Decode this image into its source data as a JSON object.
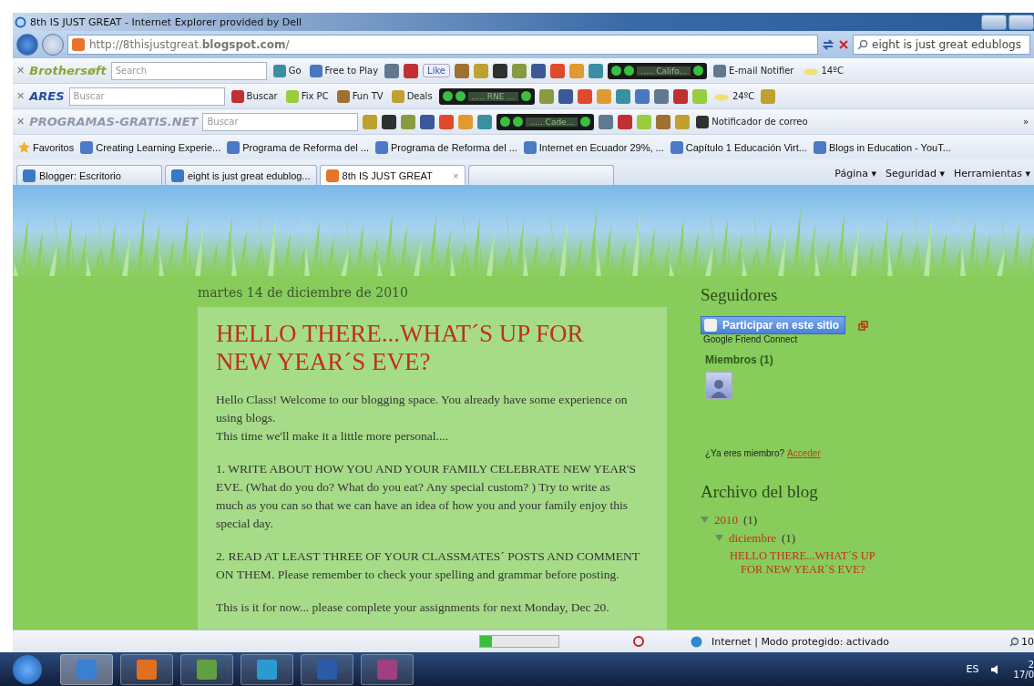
{
  "window": {
    "title": "8th IS JUST GREAT - Internet Explorer provided by Dell"
  },
  "address_bar": {
    "url": "http://8thisjustgreat.**blogspot.com**/",
    "search_value": "eight is just great edublogs"
  },
  "toolbars": [
    {
      "close": "✕",
      "items": [
        {
          "kind": "logo",
          "label": "Brothersøft"
        },
        {
          "kind": "search",
          "placeholder": "Search"
        },
        {
          "kind": "button",
          "label": "Go"
        },
        {
          "kind": "button",
          "label": "Free to Play"
        },
        {
          "kind": "icon"
        },
        {
          "kind": "icon"
        },
        {
          "kind": "like",
          "label": "Like"
        },
        {
          "kind": "icon"
        },
        {
          "kind": "icon"
        },
        {
          "kind": "icon"
        },
        {
          "kind": "icon"
        },
        {
          "kind": "icon"
        },
        {
          "kind": "icon"
        },
        {
          "kind": "icon"
        },
        {
          "kind": "icon"
        },
        {
          "kind": "player",
          "label": "..... Califo..."
        },
        {
          "kind": "button",
          "label": "E-mail Notifier"
        },
        {
          "kind": "weather",
          "label": "14ºC"
        }
      ]
    },
    {
      "close": "✕",
      "items": [
        {
          "kind": "logo",
          "label": "ARES"
        },
        {
          "kind": "search",
          "placeholder": "Buscar"
        },
        {
          "kind": "button",
          "label": "Buscar"
        },
        {
          "kind": "button",
          "label": "Fix PC"
        },
        {
          "kind": "button",
          "label": "Fun TV"
        },
        {
          "kind": "button",
          "label": "Deals"
        },
        {
          "kind": "player",
          "label": "..... RNE ..."
        },
        {
          "kind": "icon"
        },
        {
          "kind": "icon"
        },
        {
          "kind": "icon"
        },
        {
          "kind": "icon"
        },
        {
          "kind": "icon"
        },
        {
          "kind": "icon"
        },
        {
          "kind": "icon"
        },
        {
          "kind": "icon"
        },
        {
          "kind": "icon"
        },
        {
          "kind": "weather",
          "label": "24ºC"
        },
        {
          "kind": "icon"
        }
      ]
    },
    {
      "close": "✕",
      "items": [
        {
          "kind": "logo",
          "label": "PROGRAMAS-GRATIS.NET"
        },
        {
          "kind": "search",
          "placeholder": "Buscar"
        },
        {
          "kind": "icon"
        },
        {
          "kind": "icon"
        },
        {
          "kind": "icon"
        },
        {
          "kind": "icon"
        },
        {
          "kind": "icon"
        },
        {
          "kind": "icon"
        },
        {
          "kind": "icon"
        },
        {
          "kind": "player",
          "label": "..... Cade..."
        },
        {
          "kind": "icon"
        },
        {
          "kind": "icon"
        },
        {
          "kind": "icon"
        },
        {
          "kind": "icon"
        },
        {
          "kind": "icon"
        },
        {
          "kind": "button",
          "label": "Notificador de correo"
        },
        {
          "kind": "more",
          "label": "»"
        }
      ]
    }
  ],
  "favorites_bar": {
    "label": "Favoritos",
    "items": [
      "Creating Learning Experie...",
      "Programa de Reforma del ...",
      "Programa de Reforma del ...",
      "Internet en Ecuador 29%, ...",
      "Capítulo 1 Educación Virt...",
      "Blogs in Education - YouT..."
    ]
  },
  "tabs": [
    {
      "label": "Blogger: Escritorio",
      "selected": false
    },
    {
      "label": "eight is just great edublog...",
      "selected": false
    },
    {
      "label": "8th IS JUST GREAT",
      "selected": true,
      "close": "×"
    }
  ],
  "command_bar": [
    {
      "label": "Página",
      "caret": "▾"
    },
    {
      "label": "Seguridad",
      "caret": "▾"
    },
    {
      "label": "Herramientas",
      "caret": "▾"
    }
  ],
  "post": {
    "date": "martes 14 de diciembre de 2010",
    "title": "HELLO THERE...WHAT´S UP FOR NEW YEAR´S EVE?",
    "paragraphs": [
      [
        "Hello Class! Welcome to our blogging space.  You already have some experience on using blogs.",
        "This time we'll make it a little more personal...."
      ],
      [
        "1. WRITE ABOUT HOW YOU AND YOUR FAMILY CELEBRATE NEW YEAR'S EVE. (What do you do?  What do you eat? Any special custom? ) Try to write as much as you can so that we can have an idea of how you and your family enjoy this special day."
      ],
      [
        "2. READ AT LEAST THREE OF YOUR CLASSMATES´ POSTS AND COMMENT ON THEM. Please remember to check your spelling and grammar before posting."
      ],
      [
        "This is it for now... please complete your assignments for next Monday, Dec 20."
      ]
    ]
  },
  "sidebar": {
    "followers": {
      "heading": "Seguidores",
      "join_button": "Participar en este sitio",
      "provider": "Google Friend Connect",
      "members": "Miembros (1)",
      "member_prompt": "¿Ya eres miembro?",
      "sign_in": "Acceder"
    },
    "archive": {
      "heading": "Archivo del blog",
      "tree": [
        {
          "label": "2010",
          "count": "(1)",
          "expanded": true,
          "children": [
            {
              "label": "diciembre",
              "count": "(1)",
              "expanded": true,
              "children": [
                {
                  "label": "HELLO THERE...WHAT´S UP FOR NEW YEAR´S EVE?"
                }
              ]
            }
          ]
        }
      ]
    }
  },
  "status_bar": {
    "level": 0.15,
    "zone": "Internet | Modo protegido: activado",
    "zoom": "10"
  },
  "taskbar": {
    "apps": [
      {
        "color": "#3a80d0",
        "selected": true
      },
      {
        "color": "#e07020",
        "selected": false
      },
      {
        "color": "#60a040",
        "selected": false
      },
      {
        "color": "#2a9ad0",
        "selected": false
      },
      {
        "color": "#2a5aa8",
        "selected": false
      },
      {
        "color": "#a04080",
        "selected": false
      }
    ],
    "language": "ES",
    "time": "2",
    "date": "17/0"
  }
}
